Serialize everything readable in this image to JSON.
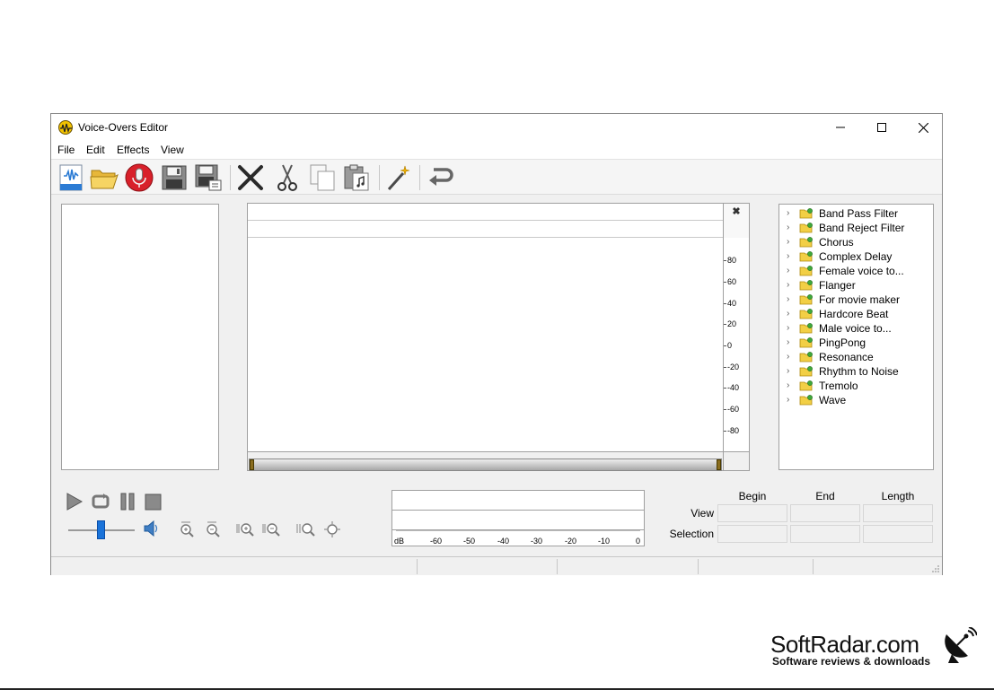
{
  "window": {
    "title": "Voice-Overs Editor"
  },
  "menu": [
    "File",
    "Edit",
    "Effects",
    "View"
  ],
  "toolbar": {
    "buttons": [
      {
        "name": "new-file",
        "icon": "waveform-document-icon"
      },
      {
        "name": "open",
        "icon": "folder-open-icon"
      },
      {
        "name": "record",
        "icon": "microphone-icon"
      },
      {
        "name": "save",
        "icon": "floppy-disk-icon"
      },
      {
        "name": "save-as",
        "icon": "floppy-disk-as-icon"
      },
      {
        "name": "delete",
        "icon": "x-delete-icon"
      },
      {
        "name": "cut",
        "icon": "scissors-icon"
      },
      {
        "name": "copy",
        "icon": "copy-pages-icon"
      },
      {
        "name": "paste",
        "icon": "clipboard-paste-icon"
      },
      {
        "name": "effects",
        "icon": "magic-wand-icon"
      },
      {
        "name": "undo",
        "icon": "undo-arrow-icon"
      }
    ]
  },
  "waveform": {
    "close_symbol": "✖",
    "db_scale": [
      "80",
      "60",
      "40",
      "20",
      "0",
      "-20",
      "-40",
      "-60",
      "-80"
    ]
  },
  "effects_tree": [
    "Band Pass Filter",
    "Band Reject Filter",
    "Chorus",
    "Complex Delay",
    "Female voice to...",
    "Flanger",
    "For movie maker",
    "Hardcore Beat",
    "Male voice to...",
    "PingPong",
    "Resonance",
    "Rhythm to Noise",
    "Tremolo",
    "Wave"
  ],
  "playback": {
    "volume_level": 0.45
  },
  "level_meter": {
    "scale": [
      "dB",
      "-60",
      "-50",
      "-40",
      "-30",
      "-20",
      "-10",
      "0"
    ]
  },
  "range": {
    "headers": [
      "Begin",
      "End",
      "Length"
    ],
    "rows": [
      "View",
      "Selection"
    ]
  },
  "watermark": {
    "title": "SoftRadar.com",
    "subtitle": "Software reviews & downloads"
  },
  "colors": {
    "volume_thumb": "#1a73d9",
    "record_red": "#d8202a",
    "titlebar": "#ffffff",
    "window_bg": "#f0f0f0"
  }
}
